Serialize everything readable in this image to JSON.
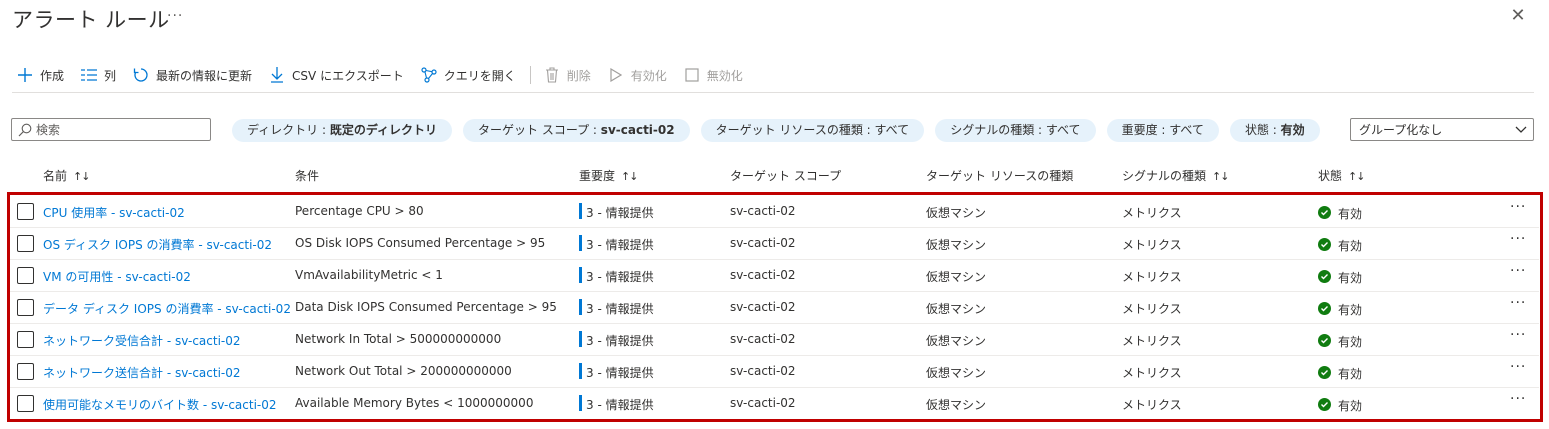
{
  "header": {
    "title": "アラート ルール",
    "more": "···",
    "close": "✕"
  },
  "toolbar": {
    "create": "作成",
    "columns": "列",
    "refresh": "最新の情報に更新",
    "export_csv": "CSV にエクスポート",
    "open_query": "クエリを開く",
    "delete": "削除",
    "enable": "有効化",
    "disable": "無効化"
  },
  "filters": {
    "search_placeholder": "検索",
    "pills": [
      {
        "label": "ディレクトリ : ",
        "value": "既定のディレクトリ"
      },
      {
        "label": "ターゲット スコープ : ",
        "value": "sv-cacti-02"
      },
      {
        "label": "ターゲット リソースの種類 : ",
        "value": "すべて"
      },
      {
        "label": "シグナルの種類 : ",
        "value": "すべて"
      },
      {
        "label": "重要度 : ",
        "value": "すべて"
      },
      {
        "label": "状態 : ",
        "value": "有効"
      }
    ],
    "group_by": "グループ化なし"
  },
  "table": {
    "columns": {
      "name": "名前",
      "condition": "条件",
      "severity": "重要度",
      "target_scope": "ターゲット スコープ",
      "target_resource_type": "ターゲット リソースの種類",
      "signal_type": "シグナルの種類",
      "status": "状態",
      "sort_icon": "↑↓"
    },
    "rows": [
      {
        "name": "CPU 使用率 - sv-cacti-02",
        "condition": "Percentage CPU > 80",
        "severity": "3 - 情報提供",
        "scope": "sv-cacti-02",
        "resource_type": "仮想マシン",
        "signal": "メトリクス",
        "status": "有効",
        "more": "···"
      },
      {
        "name": "OS ディスク IOPS の消費率 - sv-cacti-02",
        "condition": "OS Disk IOPS Consumed Percentage > 95",
        "severity": "3 - 情報提供",
        "scope": "sv-cacti-02",
        "resource_type": "仮想マシン",
        "signal": "メトリクス",
        "status": "有効",
        "more": "···"
      },
      {
        "name": "VM の可用性 - sv-cacti-02",
        "condition": "VmAvailabilityMetric < 1",
        "severity": "3 - 情報提供",
        "scope": "sv-cacti-02",
        "resource_type": "仮想マシン",
        "signal": "メトリクス",
        "status": "有効",
        "more": "···"
      },
      {
        "name": "データ ディスク IOPS の消費率 - sv-cacti-02",
        "condition": "Data Disk IOPS Consumed Percentage > 95",
        "severity": "3 - 情報提供",
        "scope": "sv-cacti-02",
        "resource_type": "仮想マシン",
        "signal": "メトリクス",
        "status": "有効",
        "more": "···"
      },
      {
        "name": "ネットワーク受信合計 - sv-cacti-02",
        "condition": "Network In Total > 500000000000",
        "severity": "3 - 情報提供",
        "scope": "sv-cacti-02",
        "resource_type": "仮想マシン",
        "signal": "メトリクス",
        "status": "有効",
        "more": "···"
      },
      {
        "name": "ネットワーク送信合計 - sv-cacti-02",
        "condition": "Network Out Total > 200000000000",
        "severity": "3 - 情報提供",
        "scope": "sv-cacti-02",
        "resource_type": "仮想マシン",
        "signal": "メトリクス",
        "status": "有効",
        "more": "···"
      },
      {
        "name": "使用可能なメモリのバイト数 - sv-cacti-02",
        "condition": "Available Memory Bytes < 1000000000",
        "severity": "3 - 情報提供",
        "scope": "sv-cacti-02",
        "resource_type": "仮想マシン",
        "signal": "メトリクス",
        "status": "有効",
        "more": "···"
      }
    ]
  },
  "colors": {
    "accent": "#0078d4",
    "status_ok": "#107c10",
    "highlight": "#c00000",
    "pill_bg": "#e6f2fb"
  }
}
